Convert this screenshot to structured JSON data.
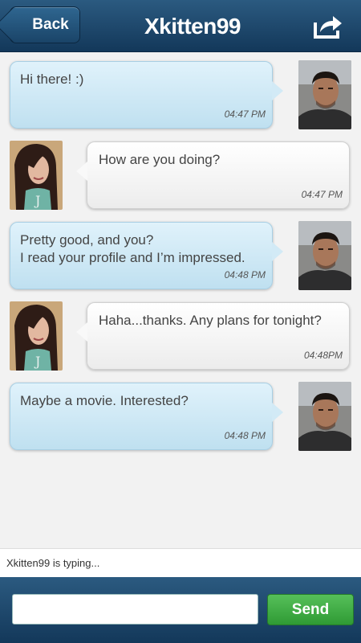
{
  "header": {
    "back_label": "Back",
    "title": "Xkitten99",
    "share_icon": "share-icon"
  },
  "messages": [
    {
      "direction": "sent",
      "text": "Hi there! :)",
      "time": "04:47 PM"
    },
    {
      "direction": "received",
      "text": "How are you doing?",
      "time": "04:47 PM"
    },
    {
      "direction": "sent",
      "text": "Pretty good, and you?\nI read your profile and I’m impressed.",
      "time": "04:48 PM"
    },
    {
      "direction": "received",
      "text": "Haha...thanks. Any plans for tonight?",
      "time": "04:48PM"
    },
    {
      "direction": "sent",
      "text": "Maybe a movie. Interested?",
      "time": "04:48 PM"
    }
  ],
  "typing_status": "Xkitten99 is typing...",
  "composer": {
    "input_value": "",
    "send_label": "Send"
  },
  "colors": {
    "header": "#1e4a70",
    "sent_bubble": "#cfe8f5",
    "received_bubble": "#f5f5f5",
    "send_button": "#3fab44"
  }
}
